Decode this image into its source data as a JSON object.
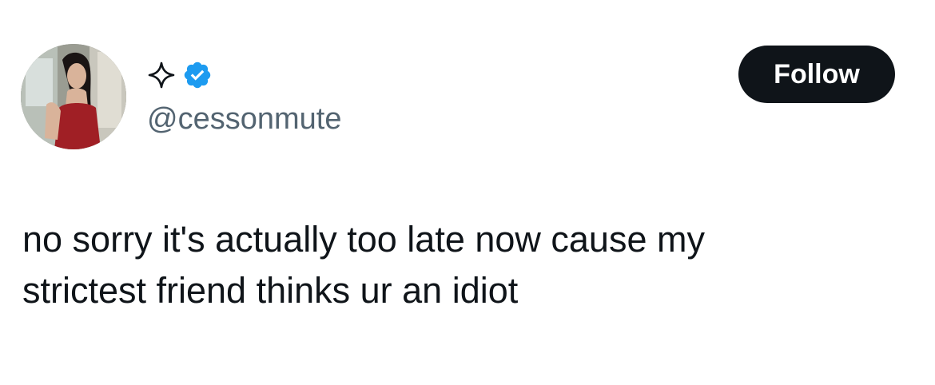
{
  "post": {
    "author": {
      "display_name_icon": "sparkle-icon",
      "verified_icon": "verified-badge-icon",
      "handle": "@cessonmute"
    },
    "follow_label": "Follow",
    "text_lines": [
      "no sorry it's actually too late now cause my",
      "strictest friend thinks ur an idiot"
    ]
  },
  "colors": {
    "text": "#0f1419",
    "secondary_text": "#536471",
    "verified_blue": "#1d9bf0",
    "button_bg": "#0f1419",
    "button_text": "#ffffff",
    "background": "#ffffff"
  }
}
